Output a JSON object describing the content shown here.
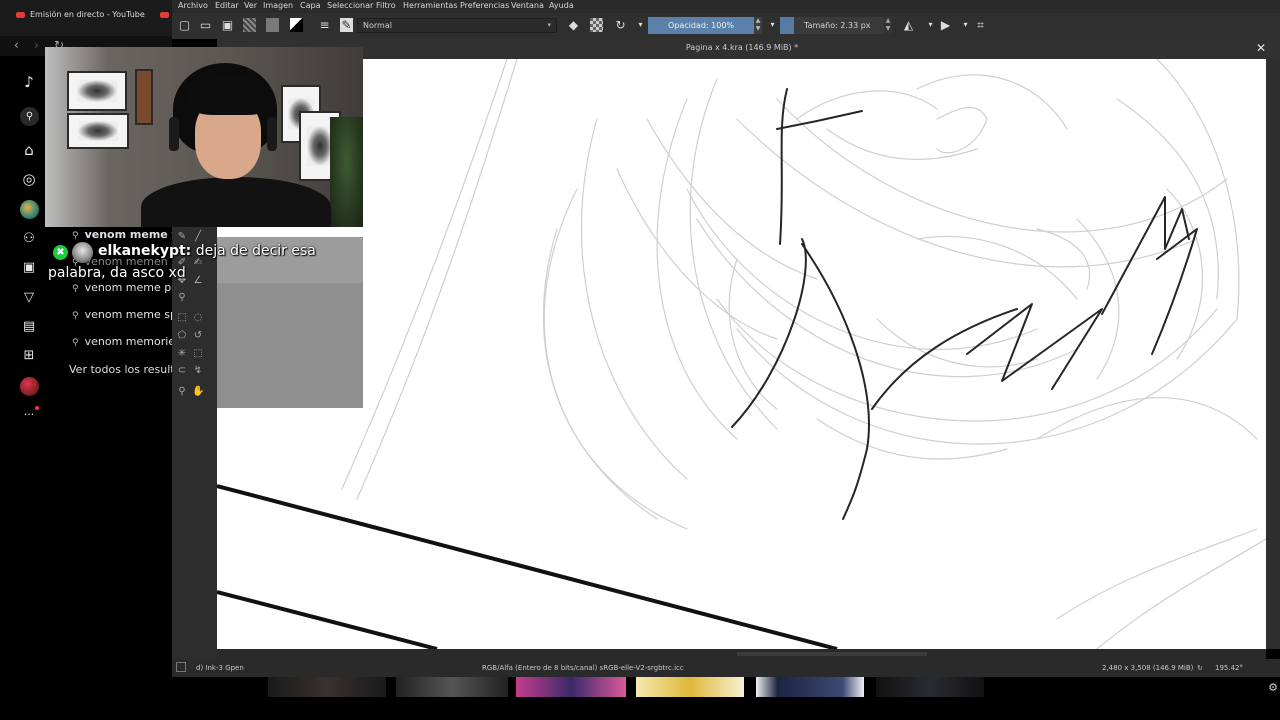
{
  "browser": {
    "tab_title": "Emisión en directo - YouTube",
    "rail_icons": [
      "tiktok-icon",
      "search-icon",
      "home-icon",
      "explore-icon",
      "avatar",
      "following-icon",
      "live-icon",
      "send-icon",
      "messages-icon",
      "upload-icon",
      "profile-avatar",
      "more-icon"
    ],
    "search_suggestions": [
      "venom meme tie",
      "venom memen",
      "venom meme pe",
      "venom meme sp",
      "venom memories"
    ],
    "see_all": "Ver todos los resultados"
  },
  "krita": {
    "menu": [
      "Archivo",
      "Editar",
      "Ver",
      "Imagen",
      "Capa",
      "Seleccionar",
      "Filtro",
      "Herramientas",
      "Preferencias",
      "Ventana",
      "Ayuda"
    ],
    "blend_mode": "Normal",
    "opacity": "Opacidad: 100%",
    "size": "Tamaño: 2.33 px",
    "document_title": "Pagina x 4.kra (146.9 MiB) *",
    "status_left": "d) Ink-3 Gpen",
    "status_center": "RGB/Alfa (Entero de 8 bits/canal)  sRGB-elle-V2-srgbtrc.icc",
    "status_dims": "2,480 x 3,508 (146.9 MiB)",
    "status_rotation": "195.42°",
    "close_glyph": "✕"
  },
  "chat": {
    "username": "elkanekypt:",
    "message": " deja de decir esa palabra, da asco xd",
    "badge": "✖"
  },
  "colors": {
    "accent": "#5b80aa",
    "badge_green": "#1dcc3b",
    "youtube_red": "#e53935"
  }
}
